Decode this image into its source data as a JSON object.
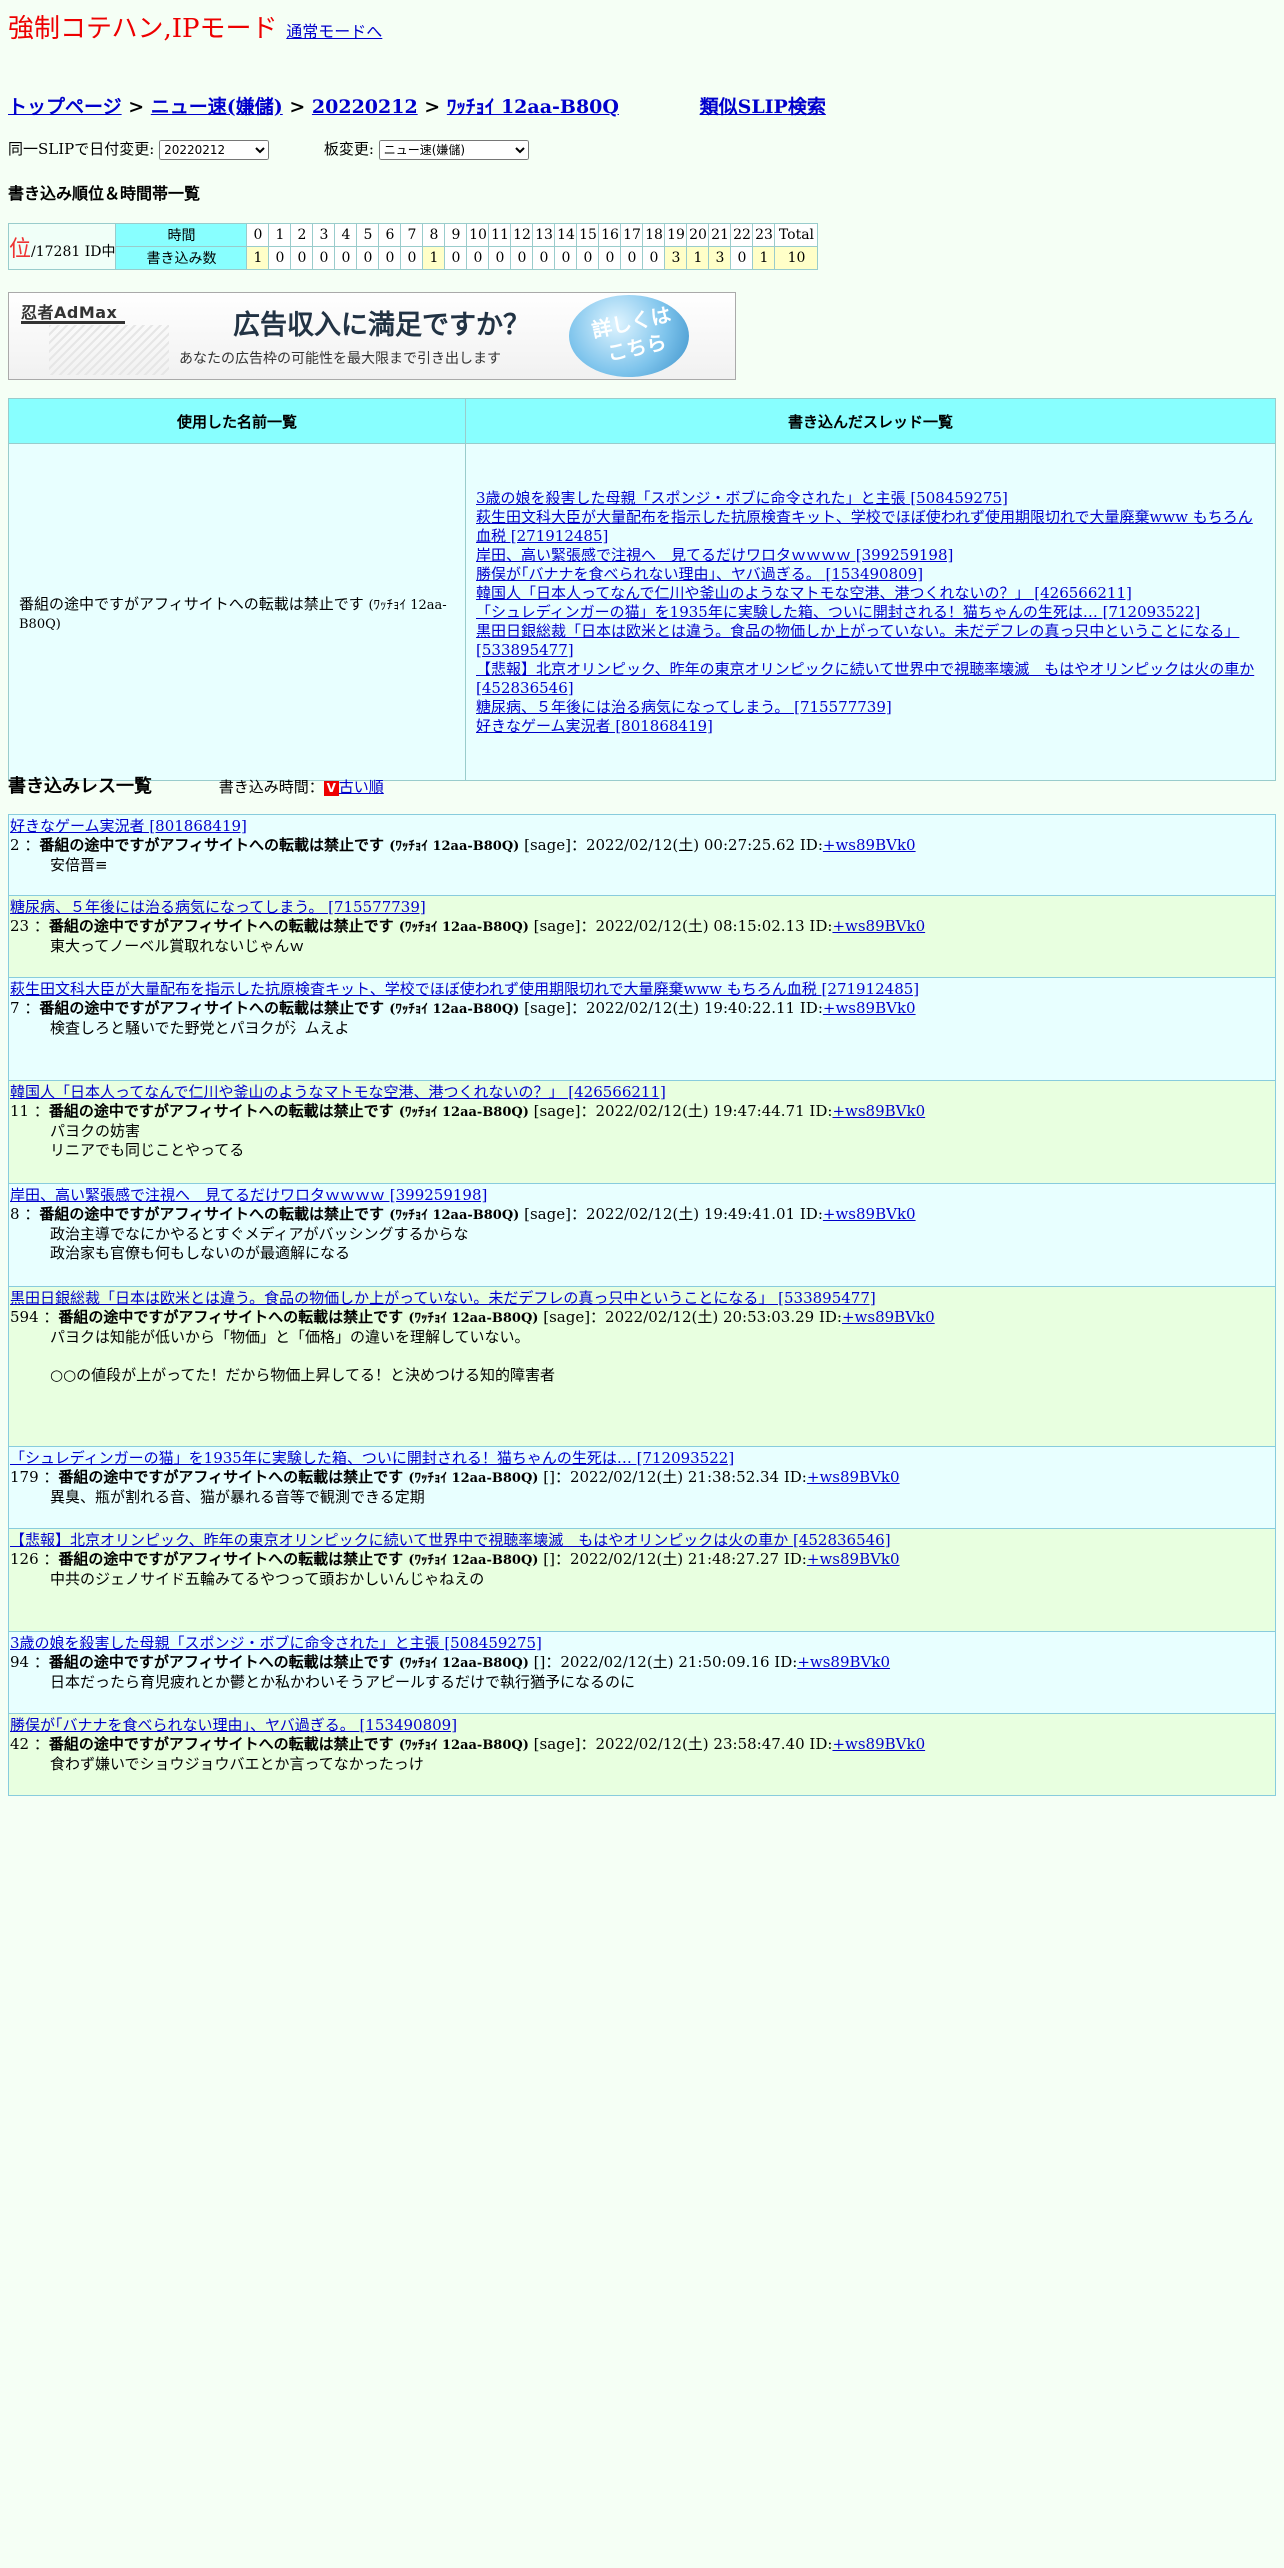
{
  "mode": {
    "title": "強制コテハン,IPモード",
    "normal_mode_link": "通常モードへ"
  },
  "breadcrumb": {
    "top": "トップページ",
    "sep1": " > ",
    "board": "ニュー速(嫌儲)",
    "sep2": " > ",
    "date": "20220212",
    "sep3": " > ",
    "slip": "ﾜｯﾁｮｲ 12aa-B80Q",
    "similar": "類似SLIP検索"
  },
  "selectors": {
    "date_label": "同一SLIPで日付変更:",
    "date_value": "20220212",
    "board_label": "板変更:",
    "board_value": "ニュー速(嫌儲)"
  },
  "ranking": {
    "title": "書き込み順位＆時間帯一覧",
    "rank_mark": "位",
    "rank_text": "/17281 ID中",
    "row_label_time": "時間",
    "row_label_count": "書き込み数",
    "hours": [
      "0",
      "1",
      "2",
      "3",
      "4",
      "5",
      "6",
      "7",
      "8",
      "9",
      "10",
      "11",
      "12",
      "13",
      "14",
      "15",
      "16",
      "17",
      "18",
      "19",
      "20",
      "21",
      "22",
      "23"
    ],
    "counts": [
      "1",
      "0",
      "0",
      "0",
      "0",
      "0",
      "0",
      "0",
      "1",
      "0",
      "0",
      "0",
      "0",
      "0",
      "0",
      "0",
      "0",
      "0",
      "0",
      "3",
      "1",
      "3",
      "0",
      "1"
    ],
    "total_label": "Total",
    "total_value": "10"
  },
  "ad": {
    "brand": "忍者AdMax",
    "headline": "広告収入に満足ですか？",
    "sub": "あなたの広告枠の可能性を最大限まで引き出します",
    "button": "詳しくはこちら"
  },
  "names_table": {
    "header_names": "使用した名前一覧",
    "header_threads": "書き込んだスレッド一覧",
    "name_main": "番組の途中ですがアフィサイトへの転載は禁止です",
    "name_slip": "(ﾜｯﾁｮｲ 12aa-B80Q)",
    "threads": [
      "3歳の娘を殺害した母親「スポンジ・ボブに命令された」と主張 [508459275]",
      "萩生田文科大臣が大量配布を指示した抗原検査キット、学校でほぼ使われず使用期限切れで大量廃棄www もちろん血税 [271912485]",
      "岸田、高い緊張感で注視へ　見てるだけワロタｗｗｗｗ [399259198]",
      "勝俣が｢バナナを食べられない理由｣、ヤバ過ぎる。 [153490809]",
      "韓国人「日本人ってなんで仁川や釜山のようなマトモな空港、港つくれないの？」 [426566211]",
      "「シュレディンガーの猫」を1935年に実験した箱、ついに開封される！猫ちゃんの生死は… [712093522]",
      "黒田日銀総裁「日本は欧米とは違う。食品の物価しか上がっていない。未だデフレの真っ只中ということになる」 [533895477]",
      "【悲報】北京オリンピック、昨年の東京オリンピックに続いて世界中で視聴率壊滅　もはやオリンピックは火の車か [452836546]",
      "糖尿病、５年後には治る病気になってしまう。 [715577739]",
      "好きなゲーム実況者 [801868419]"
    ]
  },
  "posts_header": {
    "title": "書き込みレス一覧",
    "sort_label": "書き込み時間：",
    "sort_icon": "V",
    "sort_link": "古い順"
  },
  "posts": [
    {
      "thread": "好きなゲーム実況者 [801868419]",
      "num": "2",
      "name": "番組の途中ですがアフィサイトへの転載は禁止です",
      "slip": "(ﾜｯﾁｮｲ 12aa-B80Q)",
      "mail": "[sage]",
      "date": "：2022/02/12(土) 00:27:25.62 ID:",
      "id": "+ws89BVk0",
      "body": "安倍晋≡",
      "height": 82
    },
    {
      "thread": "糖尿病、５年後には治る病気になってしまう。 [715577739]",
      "num": "23",
      "name": "番組の途中ですがアフィサイトへの転載は禁止です",
      "slip": "(ﾜｯﾁｮｲ 12aa-B80Q)",
      "mail": "[sage]",
      "date": "：2022/02/12(土) 08:15:02.13 ID:",
      "id": "+ws89BVk0",
      "body": "東大ってノーベル賞取れないじゃんｗ",
      "height": 82
    },
    {
      "thread": "萩生田文科大臣が大量配布を指示した抗原検査キット、学校でほぼ使われず使用期限切れで大量廃棄www もちろん血税 [271912485]",
      "num": "7",
      "name": "番組の途中ですがアフィサイトへの転載は禁止です",
      "slip": "(ﾜｯﾁｮｲ 12aa-B80Q)",
      "mail": "[sage]",
      "date": "：2022/02/12(土) 19:40:22.11 ID:",
      "id": "+ws89BVk0",
      "body": "検査しろと騒いでた野党とパヨクが氵ムえよ",
      "height": 103
    },
    {
      "thread": "韓国人「日本人ってなんで仁川や釜山のようなマトモな空港、港つくれないの？」 [426566211]",
      "num": "11",
      "name": "番組の途中ですがアフィサイトへの転載は禁止です",
      "slip": "(ﾜｯﾁｮｲ 12aa-B80Q)",
      "mail": "[sage]",
      "date": "：2022/02/12(土) 19:47:44.71 ID:",
      "id": "+ws89BVk0",
      "body": "パヨクの妨害\nリニアでも同じことやってる",
      "height": 103
    },
    {
      "thread": "岸田、高い緊張感で注視へ　見てるだけワロタｗｗｗｗ [399259198]",
      "num": "8",
      "name": "番組の途中ですがアフィサイトへの転載は禁止です",
      "slip": "(ﾜｯﾁｮｲ 12aa-B80Q)",
      "mail": "[sage]",
      "date": "：2022/02/12(土) 19:49:41.01 ID:",
      "id": "+ws89BVk0",
      "body": "政治主導でなにかやるとすぐメディアがバッシングするからな\n政治家も官僚も何もしないのが最適解になる",
      "height": 103
    },
    {
      "thread": "黒田日銀総裁「日本は欧米とは違う。食品の物価しか上がっていない。未だデフレの真っ只中ということになる」 [533895477]",
      "num": "594",
      "name": "番組の途中ですがアフィサイトへの転載は禁止です",
      "slip": "(ﾜｯﾁｮｲ 12aa-B80Q)",
      "mail": "[sage]",
      "date": "：2022/02/12(土) 20:53:03.29 ID:",
      "id": "+ws89BVk0",
      "body": "パヨクは知能が低いから「物価」と「価格」の違いを理解していない。\n\n○○の値段が上がってた！だから物価上昇してる！と決めつける知的障害者",
      "height": 160
    },
    {
      "thread": "「シュレディンガーの猫」を1935年に実験した箱、ついに開封される！猫ちゃんの生死は… [712093522]",
      "num": "179",
      "name": "番組の途中ですがアフィサイトへの転載は禁止です",
      "slip": "(ﾜｯﾁｮｲ 12aa-B80Q)",
      "mail": "[]",
      "date": "：2022/02/12(土) 21:38:52.34 ID:",
      "id": "+ws89BVk0",
      "body": "異臭、瓶が割れる音、猫が暴れる音等で観測できる定期",
      "height": 82
    },
    {
      "thread": "【悲報】北京オリンピック、昨年の東京オリンピックに続いて世界中で視聴率壊滅　もはやオリンピックは火の車か [452836546]",
      "num": "126",
      "name": "番組の途中ですがアフィサイトへの転載は禁止です",
      "slip": "(ﾜｯﾁｮｲ 12aa-B80Q)",
      "mail": "[]",
      "date": "：2022/02/12(土) 21:48:27.27 ID:",
      "id": "+ws89BVk0",
      "body": "中共のジェノサイド五輪みてるやつって頭おかしいんじゃねえの",
      "height": 103
    },
    {
      "thread": "3歳の娘を殺害した母親「スポンジ・ボブに命令された」と主張 [508459275]",
      "num": "94",
      "name": "番組の途中ですがアフィサイトへの転載は禁止です",
      "slip": "(ﾜｯﾁｮｲ 12aa-B80Q)",
      "mail": "[]",
      "date": "：2022/02/12(土) 21:50:09.16 ID:",
      "id": "+ws89BVk0",
      "body": "日本だったら育児疲れとか鬱とか私かわいそうアピールするだけで執行猶予になるのに",
      "height": 82
    },
    {
      "thread": "勝俣が｢バナナを食べられない理由｣、ヤバ過ぎる。 [153490809]",
      "num": "42",
      "name": "番組の途中ですがアフィサイトへの転載は禁止です",
      "slip": "(ﾜｯﾁｮｲ 12aa-B80Q)",
      "mail": "[sage]",
      "date": "：2022/02/12(土) 23:58:47.40 ID:",
      "id": "+ws89BVk0",
      "body": "食わず嫌いでショウジョウバエとか言ってなかったっけ",
      "height": 82
    }
  ]
}
